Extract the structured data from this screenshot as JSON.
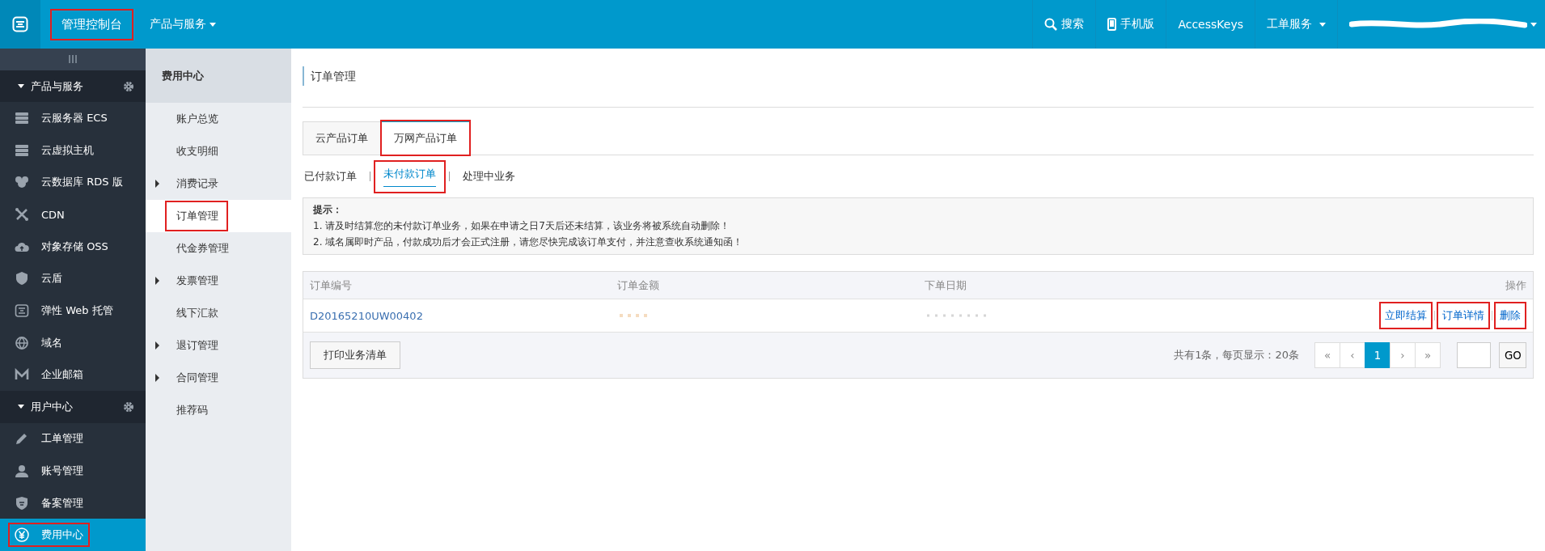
{
  "topbar": {
    "console": {
      "label": "管理控制台",
      "marked": true
    },
    "products_menu": "产品与服务",
    "links": [
      {
        "label": "搜索",
        "kind": "search"
      },
      {
        "label": "手机版",
        "kind": "phone"
      },
      {
        "label": "AccessKeys",
        "kind": "plain"
      },
      {
        "label": "工单服务",
        "kind": "dropdown"
      }
    ]
  },
  "sidebar": {
    "sections": [
      {
        "title": "产品与服务",
        "items": [
          {
            "label": "云服务器 ECS",
            "selected": false,
            "marked": false
          },
          {
            "label": "云虚拟主机",
            "selected": false,
            "marked": false
          },
          {
            "label": "云数据库 RDS 版",
            "selected": false,
            "marked": false
          },
          {
            "label": "CDN",
            "selected": false,
            "marked": false
          },
          {
            "label": "对象存储 OSS",
            "selected": false,
            "marked": false
          },
          {
            "label": "云盾",
            "selected": false,
            "marked": false
          },
          {
            "label": "弹性 Web 托管",
            "selected": false,
            "marked": false
          },
          {
            "label": "域名",
            "selected": false,
            "marked": false
          },
          {
            "label": "企业邮箱",
            "selected": false,
            "marked": false
          }
        ]
      },
      {
        "title": "用户中心",
        "items": [
          {
            "label": "工单管理",
            "selected": false,
            "marked": false
          },
          {
            "label": "账号管理",
            "selected": false,
            "marked": false
          },
          {
            "label": "备案管理",
            "selected": false,
            "marked": false
          },
          {
            "label": "费用中心",
            "selected": true,
            "marked": true
          }
        ]
      }
    ]
  },
  "submenu": {
    "title": "费用中心",
    "items": [
      {
        "label": "账户总览",
        "expandable": false,
        "selected": false,
        "marked": false
      },
      {
        "label": "收支明细",
        "expandable": false,
        "selected": false,
        "marked": false
      },
      {
        "label": "消费记录",
        "expandable": true,
        "selected": false,
        "marked": false
      },
      {
        "label": "订单管理",
        "expandable": false,
        "selected": true,
        "marked": true
      },
      {
        "label": "代金券管理",
        "expandable": false,
        "selected": false,
        "marked": false
      },
      {
        "label": "发票管理",
        "expandable": true,
        "selected": false,
        "marked": false
      },
      {
        "label": "线下汇款",
        "expandable": false,
        "selected": false,
        "marked": false
      },
      {
        "label": "退订管理",
        "expandable": true,
        "selected": false,
        "marked": false
      },
      {
        "label": "合同管理",
        "expandable": true,
        "selected": false,
        "marked": false
      },
      {
        "label": "推荐码",
        "expandable": false,
        "selected": false,
        "marked": false
      }
    ]
  },
  "page_title": "订单管理",
  "tabs": [
    {
      "label": "云产品订单",
      "selected": false,
      "marked": false
    },
    {
      "label": "万网产品订单",
      "selected": true,
      "marked": true
    }
  ],
  "subtabs": [
    {
      "label": "已付款订单",
      "selected": false,
      "marked": false
    },
    {
      "label": "未付款订单",
      "selected": true,
      "marked": true
    },
    {
      "label": "处理中业务",
      "selected": false,
      "marked": false
    }
  ],
  "notice": {
    "title": "提示：",
    "lines": [
      "1. 请及时结算您的未付款订单业务，如果在申请之日7天后还未结算，该业务将被系统自动删除！",
      "2. 域名属即时产品，付款成功后才会正式注册，请您尽快完成该订单支付，并注意查收系统通知函！"
    ]
  },
  "table": {
    "columns": [
      "订单编号",
      "订单金额",
      "下单日期",
      "操作"
    ],
    "rows": [
      {
        "order_no": "D20165210UW00402",
        "actions": [
          {
            "label": "立即结算",
            "marked": true
          },
          {
            "label": "订单详情",
            "marked": true
          },
          {
            "label": "删除",
            "marked": true
          }
        ]
      }
    ]
  },
  "footer": {
    "print_button": "打印业务清单",
    "summary": "共有1条，每页显示：20条",
    "pages": [
      {
        "label": "«",
        "selected": false
      },
      {
        "label": "‹",
        "selected": false
      },
      {
        "label": "1",
        "selected": true
      },
      {
        "label": "›",
        "selected": false
      },
      {
        "label": "»",
        "selected": false
      }
    ],
    "go_button": "GO"
  }
}
